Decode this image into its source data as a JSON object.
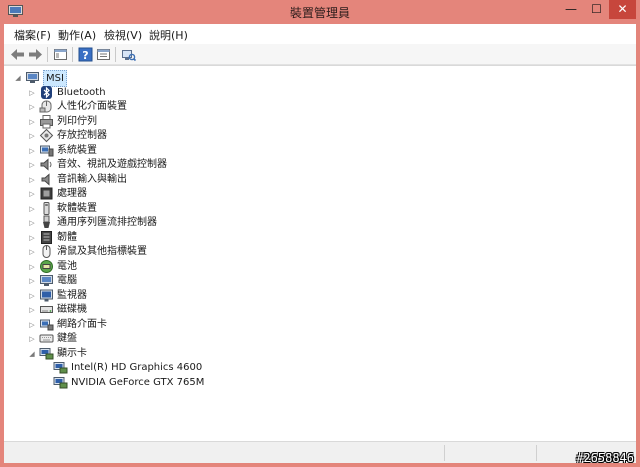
{
  "window": {
    "title": "裝置管理員",
    "controls": {
      "minimize": "—",
      "maximize": "☐",
      "close": "✕"
    }
  },
  "menu": [
    {
      "label": "檔案(F)"
    },
    {
      "label": "動作(A)"
    },
    {
      "label": "檢視(V)"
    },
    {
      "label": "說明(H)"
    }
  ],
  "toolbar": [
    "back-icon",
    "forward-icon",
    "console-tree-icon",
    "help-icon",
    "properties-icon",
    "scan-hardware-icon"
  ],
  "tree": {
    "root": {
      "label": "MSI",
      "expanded": true,
      "icon": "computer-icon"
    },
    "categories": [
      {
        "label": "Bluetooth",
        "icon": "bluetooth-icon",
        "expanded": false
      },
      {
        "label": "人性化介面裝置",
        "icon": "hid-icon",
        "expanded": false
      },
      {
        "label": "列印佇列",
        "icon": "printer-icon",
        "expanded": false
      },
      {
        "label": "存放控制器",
        "icon": "storage-controller-icon",
        "expanded": false
      },
      {
        "label": "系統裝置",
        "icon": "system-device-icon",
        "expanded": false
      },
      {
        "label": "音效、視訊及遊戲控制器",
        "icon": "speaker-icon",
        "expanded": false
      },
      {
        "label": "音訊輸入與輸出",
        "icon": "audio-io-icon",
        "expanded": false
      },
      {
        "label": "處理器",
        "icon": "processor-icon",
        "expanded": false
      },
      {
        "label": "軟體裝置",
        "icon": "software-device-icon",
        "expanded": false
      },
      {
        "label": "通用序列匯流排控制器",
        "icon": "usb-icon",
        "expanded": false
      },
      {
        "label": "韌體",
        "icon": "firmware-icon",
        "expanded": false
      },
      {
        "label": "滑鼠及其他指標裝置",
        "icon": "mouse-icon",
        "expanded": false
      },
      {
        "label": "電池",
        "icon": "battery-icon",
        "expanded": false
      },
      {
        "label": "電腦",
        "icon": "computer-icon",
        "expanded": false
      },
      {
        "label": "監視器",
        "icon": "monitor-icon",
        "expanded": false
      },
      {
        "label": "磁碟機",
        "icon": "disk-drive-icon",
        "expanded": false
      },
      {
        "label": "網路介面卡",
        "icon": "network-adapter-icon",
        "expanded": false
      },
      {
        "label": "鍵盤",
        "icon": "keyboard-icon",
        "expanded": false
      },
      {
        "label": "顯示卡",
        "icon": "display-adapter-icon",
        "expanded": true,
        "children": [
          {
            "label": "Intel(R) HD Graphics 4600",
            "icon": "display-adapter-icon"
          },
          {
            "label": "NVIDIA GeForce GTX 765M",
            "icon": "display-adapter-icon"
          }
        ]
      }
    ]
  },
  "colors": {
    "title_bar": "#e4857b",
    "close_button": "#c7463c",
    "selection": "#cce8ff"
  },
  "watermark": "#2658846"
}
